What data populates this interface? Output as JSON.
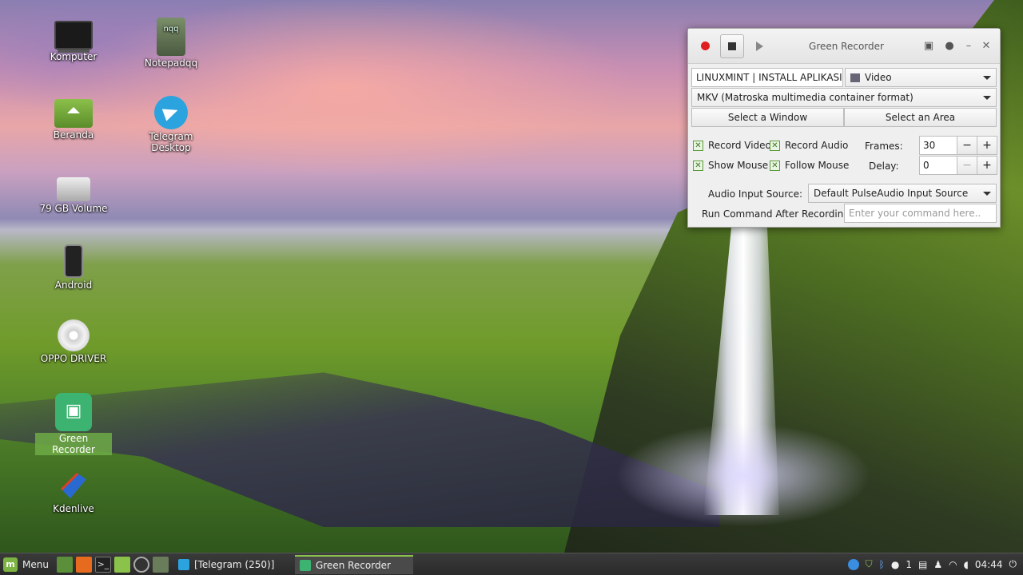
{
  "desktop": {
    "icons": [
      {
        "label": "Komputer",
        "icon": "monitor-icon"
      },
      {
        "label": "Notepadqq",
        "icon": "notepadqq-icon",
        "glyph_text": "nqq"
      },
      {
        "label": "Beranda",
        "icon": "home-folder-icon"
      },
      {
        "label": "Telegram Desktop",
        "icon": "telegram-icon"
      },
      {
        "label": "79 GB Volume",
        "icon": "drive-icon"
      },
      {
        "label": "Android",
        "icon": "phone-icon"
      },
      {
        "label": "OPPO DRIVER",
        "icon": "cd-icon"
      },
      {
        "label": "Green Recorder",
        "icon": "green-recorder-icon"
      },
      {
        "label": "Kdenlive",
        "icon": "kdenlive-icon"
      }
    ]
  },
  "recorder": {
    "title": "Green Recorder",
    "filename_value": "LINUXMINT | INSTALL APLIKASI",
    "type_select": "Video",
    "format_select": "MKV (Matroska multimedia container format)",
    "select_window_label": "Select a Window",
    "select_area_label": "Select an Area",
    "record_video_label": "Record Video",
    "record_audio_label": "Record Audio",
    "show_mouse_label": "Show Mouse",
    "follow_mouse_label": "Follow Mouse",
    "frames_label": "Frames:",
    "frames_value": "30",
    "delay_label": "Delay:",
    "delay_value": "0",
    "audio_source_label": "Audio Input Source:",
    "audio_source_value": "Default PulseAudio Input Source",
    "run_command_label": "Run Command After Recording:",
    "run_command_placeholder": "Enter your command here..",
    "checkbox_states": {
      "record_video": true,
      "record_audio": true,
      "show_mouse": true,
      "follow_mouse": true
    }
  },
  "taskbar": {
    "menu_label": "Menu",
    "tasks": [
      {
        "label": "[Telegram (250)]",
        "icon": "telegram-icon",
        "active": false
      },
      {
        "label": "Green Recorder",
        "icon": "green-recorder-icon",
        "active": true
      }
    ],
    "tray_count": "1",
    "clock": "04:44"
  },
  "colors": {
    "accent": "#8bc34a",
    "record_red": "#e02020",
    "telegram_blue": "#2aa3de",
    "recorder_green": "#3cb371"
  }
}
